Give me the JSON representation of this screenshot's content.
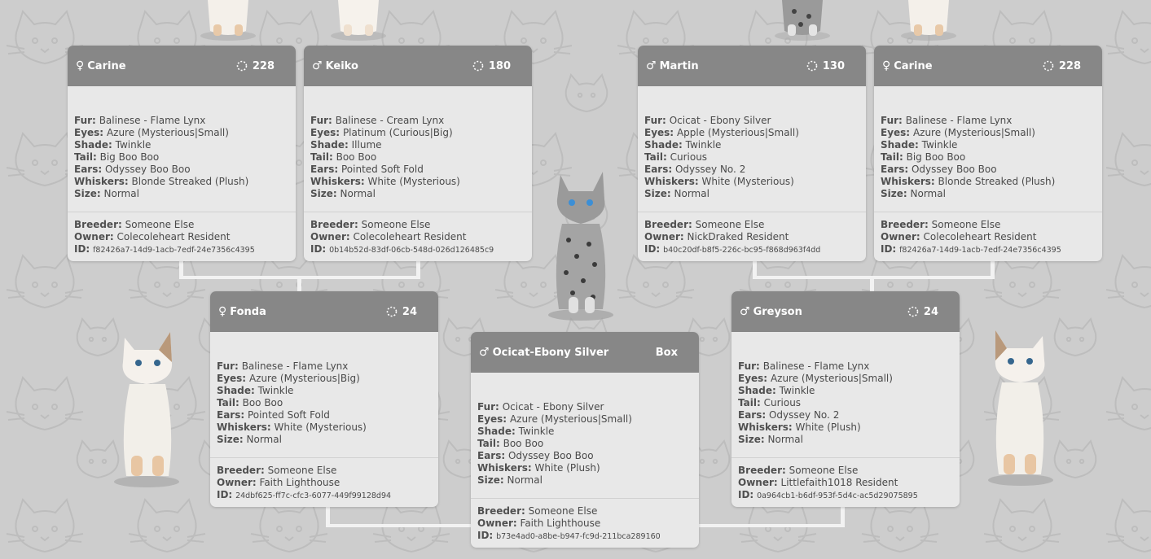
{
  "labels": {
    "fur": "Fur:",
    "eyes": "Eyes:",
    "shade": "Shade:",
    "tail": "Tail:",
    "ears": "Ears:",
    "whiskers": "Whiskers:",
    "size": "Size:",
    "breeder": "Breeder:",
    "owner": "Owner:",
    "id": "ID:"
  },
  "cards": {
    "carine_left": {
      "gender": "♀",
      "name": "Carine",
      "generation": "228",
      "fur": "Balinese - Flame Lynx",
      "eyes": "Azure (Mysterious|Small)",
      "shade": "Twinkle",
      "tail": "Big Boo Boo",
      "ears": "Odyssey Boo Boo",
      "whiskers": "Blonde Streaked (Plush)",
      "size": "Normal",
      "breeder": "Someone Else",
      "owner": "Colecoleheart Resident",
      "id": "f82426a7-14d9-1acb-7edf-24e7356c4395"
    },
    "keiko": {
      "gender": "♂",
      "name": "Keiko",
      "generation": "180",
      "fur": "Balinese - Cream Lynx",
      "eyes": "Platinum (Curious|Big)",
      "shade": "Illume",
      "tail": "Boo Boo",
      "ears": "Pointed Soft Fold",
      "whiskers": "White (Mysterious)",
      "size": "Normal",
      "breeder": "Someone Else",
      "owner": "Colecoleheart Resident",
      "id": "0b14b52d-83df-06cb-548d-026d126485c9"
    },
    "martin": {
      "gender": "♂",
      "name": "Martin",
      "generation": "130",
      "fur": "Ocicat - Ebony Silver",
      "eyes": "Apple (Mysterious|Small)",
      "shade": "Twinkle",
      "tail": "Curious",
      "ears": "Odyssey No. 2",
      "whiskers": "White (Mysterious)",
      "size": "Normal",
      "breeder": "Someone Else",
      "owner": "NickDraked Resident",
      "id": "b40c20df-b8f5-226c-bc95-f868d963f4dd"
    },
    "carine_right": {
      "gender": "♀",
      "name": "Carine",
      "generation": "228",
      "fur": "Balinese - Flame Lynx",
      "eyes": "Azure (Mysterious|Small)",
      "shade": "Twinkle",
      "tail": "Big Boo Boo",
      "ears": "Odyssey Boo Boo",
      "whiskers": "Blonde Streaked (Plush)",
      "size": "Normal",
      "breeder": "Someone Else",
      "owner": "Colecoleheart Resident",
      "id": "f82426a7-14d9-1acb-7edf-24e7356c4395"
    },
    "fonda": {
      "gender": "♀",
      "name": "Fonda",
      "generation": "24",
      "fur": "Balinese - Flame Lynx",
      "eyes": "Azure (Mysterious|Big)",
      "shade": "Twinkle",
      "tail": "Boo Boo",
      "ears": "Pointed Soft Fold",
      "whiskers": "White (Mysterious)",
      "size": "Normal",
      "breeder": "Someone Else",
      "owner": "Faith Lighthouse",
      "id": "24dbf625-ff7c-cfc3-6077-449f99128d94"
    },
    "greyson": {
      "gender": "♂",
      "name": "Greyson",
      "generation": "24",
      "fur": "Balinese - Flame Lynx",
      "eyes": "Azure (Mysterious|Small)",
      "shade": "Twinkle",
      "tail": "Curious",
      "ears": "Odyssey No. 2",
      "whiskers": "White (Plush)",
      "size": "Normal",
      "breeder": "Someone Else",
      "owner": "Littlefaith1018 Resident",
      "id": "0a964cb1-b6df-953f-5d4c-ac5d29075895"
    },
    "main": {
      "gender": "♂",
      "name": "Ocicat-Ebony Silver",
      "box": "Box",
      "fur": "Ocicat - Ebony Silver",
      "eyes": "Azure (Mysterious|Small)",
      "shade": "Twinkle",
      "tail": "Boo Boo",
      "ears": "Odyssey Boo Boo",
      "whiskers": "White (Plush)",
      "size": "Normal",
      "breeder": "Someone Else",
      "owner": "Faith Lighthouse",
      "id": "b73e4ad0-a8be-b947-fc9d-211bca289160"
    }
  }
}
